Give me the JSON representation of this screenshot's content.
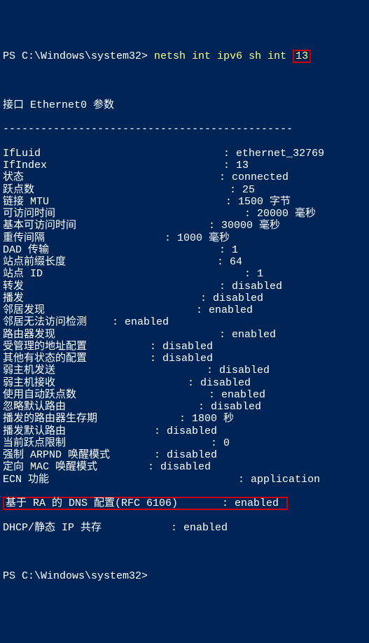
{
  "prompt1": "PS C:\\Windows\\system32> ",
  "cmd_prefix": "netsh int ipv6 sh int ",
  "cmd_arg": "13",
  "header": "接口 Ethernet0 参数",
  "divider": "----------------------------------------------",
  "rows": [
    "IfLuid                             : ethernet_32769",
    "IfIndex                            : 13",
    "状态                               : connected",
    "跃点数                               : 25",
    "链接 MTU                            : 1500 字节",
    "可访问时间                              : 20000 毫秒",
    "基本可访问时间                     : 30000 毫秒",
    "重传间隔                   : 1000 毫秒",
    "DAD 传输                           : 1",
    "站点前缀长度                        : 64",
    "站点 ID                                : 1",
    "转发                               : disabled",
    "播发                            : disabled",
    "邻居发现                        : enabled",
    "邻居无法访问检测    : enabled",
    "路由器发现                          : enabled",
    "受管理的地址配置          : disabled",
    "其他有状态的配置          : disabled",
    "弱主机发送                        : disabled",
    "弱主机接收                     : disabled",
    "使用自动跃点数                     : enabled",
    "忽略默认路由                     : disabled",
    "播发的路由器生存期             : 1800 秒",
    "播发默认路由              : disabled",
    "当前跃点限制                       : 0",
    "强制 ARPND 唤醒模式       : disabled",
    "定向 MAC 唤醒模式        : disabled",
    "ECN 功能                              : application"
  ],
  "highlight_row": "基于 RA 的 DNS 配置(RFC 6106)       : enabled ",
  "tail_row": "DHCP/静态 IP 共存           : enabled",
  "prompt2": "PS C:\\Windows\\system32> "
}
